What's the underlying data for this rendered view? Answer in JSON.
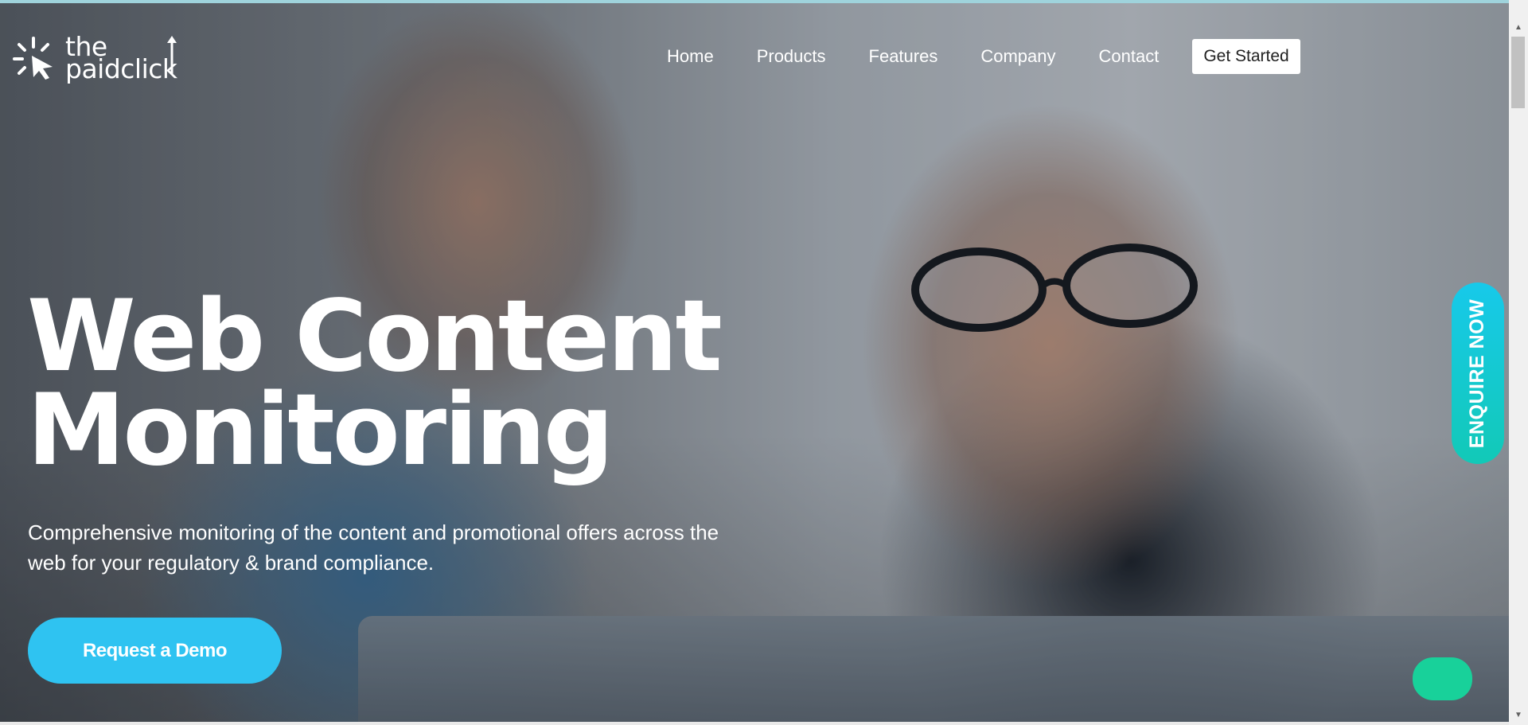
{
  "brand": {
    "logo_line1": "the",
    "logo_line2": "paidclick"
  },
  "nav": {
    "items": [
      "Home",
      "Products",
      "Features",
      "Company",
      "Contact"
    ],
    "cta": "Get Started"
  },
  "hero": {
    "title_line1": "Web Content",
    "title_line2": "Monitoring",
    "subtitle": "Comprehensive monitoring of the content and promotional offers across the web for your regulatory & brand compliance.",
    "cta": "Request a Demo"
  },
  "side_tab": {
    "label": "ENQUIRE NOW"
  },
  "colors": {
    "cta_blue": "#2fc3f1",
    "enquire_gradient_top": "#17c9ea",
    "enquire_gradient_bottom": "#12c9b7",
    "chat_green": "#18d19a"
  },
  "icons": {
    "logo": "cursor-burst-icon",
    "chat": "chat-bubble-icon"
  }
}
